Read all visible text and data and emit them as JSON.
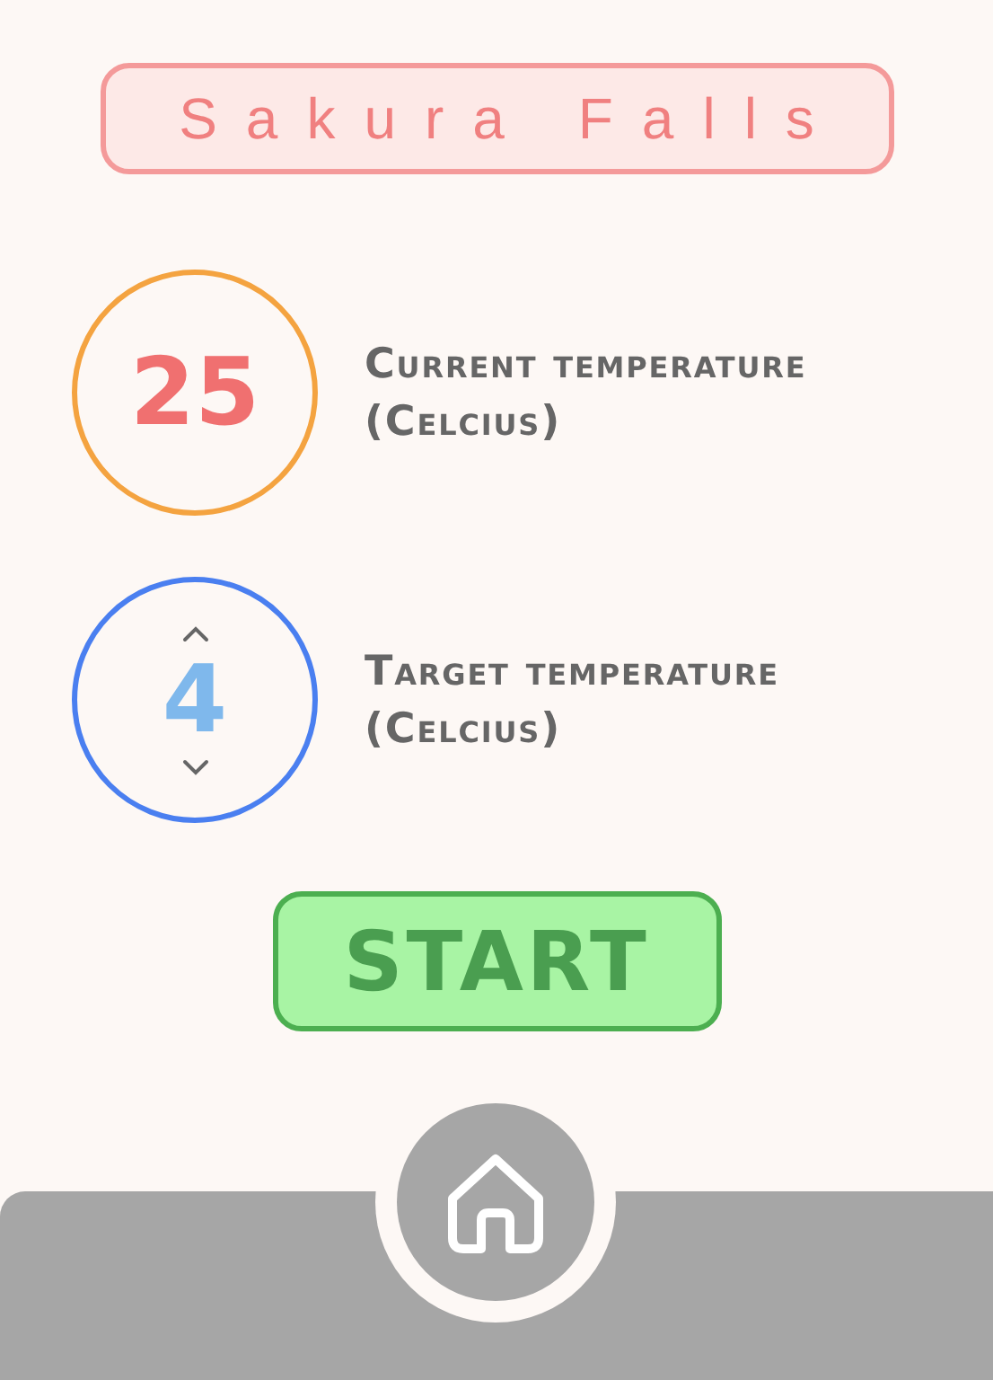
{
  "title": "Sakura Falls",
  "current": {
    "value": "25",
    "label": "Current temperature",
    "unit": "(Celcius)"
  },
  "target": {
    "value": "4",
    "label": "Target temperature",
    "unit": "(Celcius)"
  },
  "start_button": "START"
}
